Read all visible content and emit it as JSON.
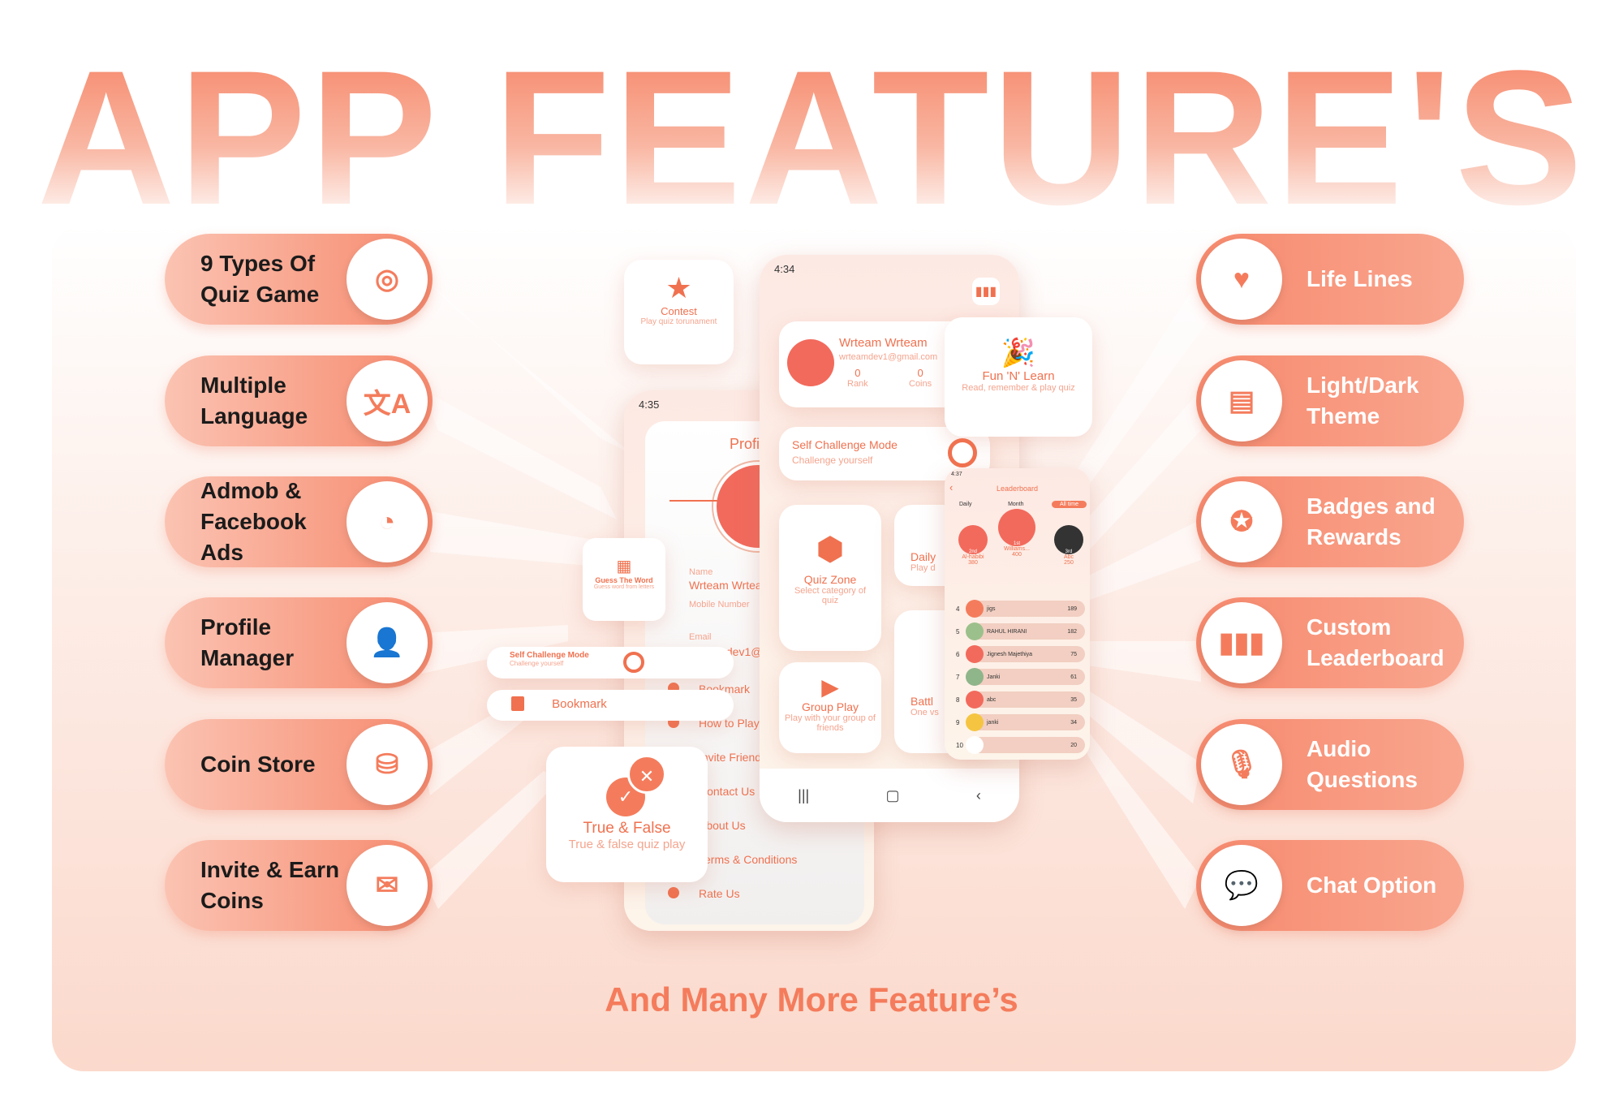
{
  "title": "APP FEATURE'S",
  "footer": "And Many More Feature’s",
  "colors": {
    "accent": "#f47c5c",
    "pill": "#f6896d",
    "text": "#1b1b1b"
  },
  "left_features": [
    {
      "label": "9 Types Of Quiz Game",
      "icon": "quiz-search-icon"
    },
    {
      "label": "Multiple Language",
      "icon": "translate-icon"
    },
    {
      "label": "Admob & Facebook Ads",
      "icon": "ads-icon"
    },
    {
      "label": "Profile Manager",
      "icon": "user-gear-icon"
    },
    {
      "label": "Coin Store",
      "icon": "coins-icon"
    },
    {
      "label": "Invite & Earn Coins",
      "icon": "envelope-heart-icon"
    }
  ],
  "right_features": [
    {
      "label": "Life Lines",
      "icon": "heart-hand-icon"
    },
    {
      "label": "Light/Dark Theme",
      "icon": "theme-icon"
    },
    {
      "label": "Badges and Rewards",
      "icon": "badge-icon"
    },
    {
      "label": "Custom Leaderboard",
      "icon": "leaderboard-icon"
    },
    {
      "label": "Audio Questions",
      "icon": "microphone-icon"
    },
    {
      "label": "Chat Option",
      "icon": "chat-icon"
    }
  ],
  "contest": {
    "title": "Contest",
    "sub": "Play quiz torunament"
  },
  "fun": {
    "title": "Fun 'N' Learn",
    "sub": "Read, remember & play quiz"
  },
  "guess": {
    "title": "Guess The Word",
    "sub": "Guess word from letters"
  },
  "self_pill": {
    "title": "Self Challenge Mode",
    "sub": "Challenge yourself"
  },
  "bookmark_pill": {
    "label": "Bookmark"
  },
  "truefalse": {
    "title": "True & False",
    "sub": "True & false quiz play"
  },
  "main_phone": {
    "time": "4:34",
    "profile": {
      "name": "Wrteam Wrteam",
      "email": "wrteamdev1@gmail.com",
      "rank": "0",
      "rank_label": "Rank",
      "coins": "0",
      "coins_label": "Coins"
    },
    "self": {
      "title": "Self Challenge Mode",
      "sub": "Challenge yourself"
    },
    "quiz_zone": {
      "title": "Quiz Zone",
      "sub": "Select category of quiz"
    },
    "daily": {
      "title": "Daily",
      "sub": "Play d"
    },
    "group": {
      "title": "Group Play",
      "sub": "Play with your group of friends"
    },
    "battle": {
      "title": "Battl",
      "sub": "One vs"
    }
  },
  "profile_phone": {
    "time": "4:35",
    "heading": "Profi",
    "name_label": "Name",
    "name": "Wrteam Wrteam",
    "mobile_label": "Mobile Number",
    "email_label": "Email",
    "email": "wrteamdev1@",
    "menu": [
      "Bookmark",
      "How to Play",
      "Invite Friends",
      "Contact Us",
      "About Us",
      "Terms & Conditions",
      "Rate Us"
    ]
  },
  "leaderboard": {
    "time": "4:37",
    "title": "Leaderboard",
    "tabs": [
      "Daily",
      "Month",
      "All time"
    ],
    "active_tab": "All time",
    "podium": [
      {
        "place": "2nd",
        "name": "Al-habibi",
        "score": "380"
      },
      {
        "place": "1st",
        "name": "Williams...",
        "score": "400"
      },
      {
        "place": "3rd",
        "name": "Abc",
        "score": "250"
      }
    ],
    "rows": [
      {
        "rank": "4",
        "name": "jigs",
        "score": "189"
      },
      {
        "rank": "5",
        "name": "RAHUL HIRANI",
        "score": "182"
      },
      {
        "rank": "6",
        "name": "Jignesh Majethiya",
        "score": "75"
      },
      {
        "rank": "7",
        "name": "Janki",
        "score": "61"
      },
      {
        "rank": "8",
        "name": "abc",
        "score": "35"
      },
      {
        "rank": "9",
        "name": "janki",
        "score": "34"
      },
      {
        "rank": "10",
        "name": "",
        "score": "20"
      }
    ]
  }
}
